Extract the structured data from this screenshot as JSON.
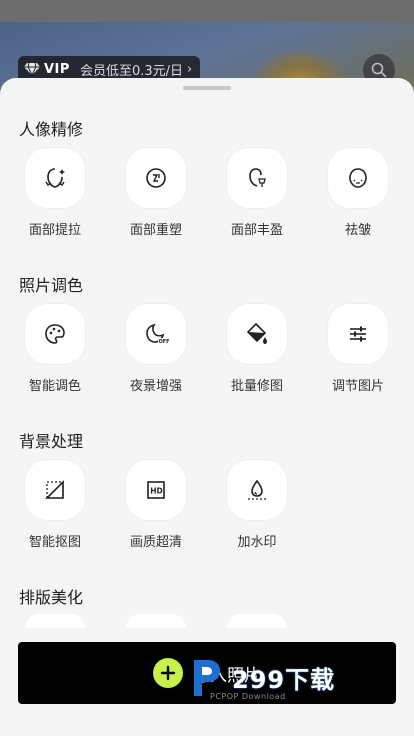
{
  "header": {
    "vip_badge": "VIP",
    "vip_promo": "会员低至0.3元/日",
    "vip_chevron": "›"
  },
  "sections": [
    {
      "title": "人像精修",
      "tools": [
        {
          "label": "面部提拉",
          "icon": "face-lift-icon"
        },
        {
          "label": "面部重塑",
          "icon": "face-reshape-icon"
        },
        {
          "label": "面部丰盈",
          "icon": "face-plump-icon"
        },
        {
          "label": "祛皱",
          "icon": "wrinkle-removal-icon"
        }
      ]
    },
    {
      "title": "照片调色",
      "tools": [
        {
          "label": "智能调色",
          "icon": "palette-icon"
        },
        {
          "label": "夜景增强",
          "icon": "night-enhance-icon"
        },
        {
          "label": "批量修图",
          "icon": "batch-edit-icon"
        },
        {
          "label": "调节图片",
          "icon": "sliders-icon"
        }
      ]
    },
    {
      "title": "背景处理",
      "tools": [
        {
          "label": "智能抠图",
          "icon": "cutout-icon"
        },
        {
          "label": "画质超清",
          "icon": "hd-icon"
        },
        {
          "label": "加水印",
          "icon": "watermark-icon"
        }
      ]
    },
    {
      "title": "排版美化",
      "tools": []
    }
  ],
  "import_button": {
    "label": "导入照片"
  },
  "watermark": {
    "main": "299下载",
    "sub": "PCPOP Download"
  },
  "colors": {
    "sheet_bg": "#f5f5f5",
    "accent_green": "#c6f24a",
    "import_bar_bg": "#000000"
  }
}
